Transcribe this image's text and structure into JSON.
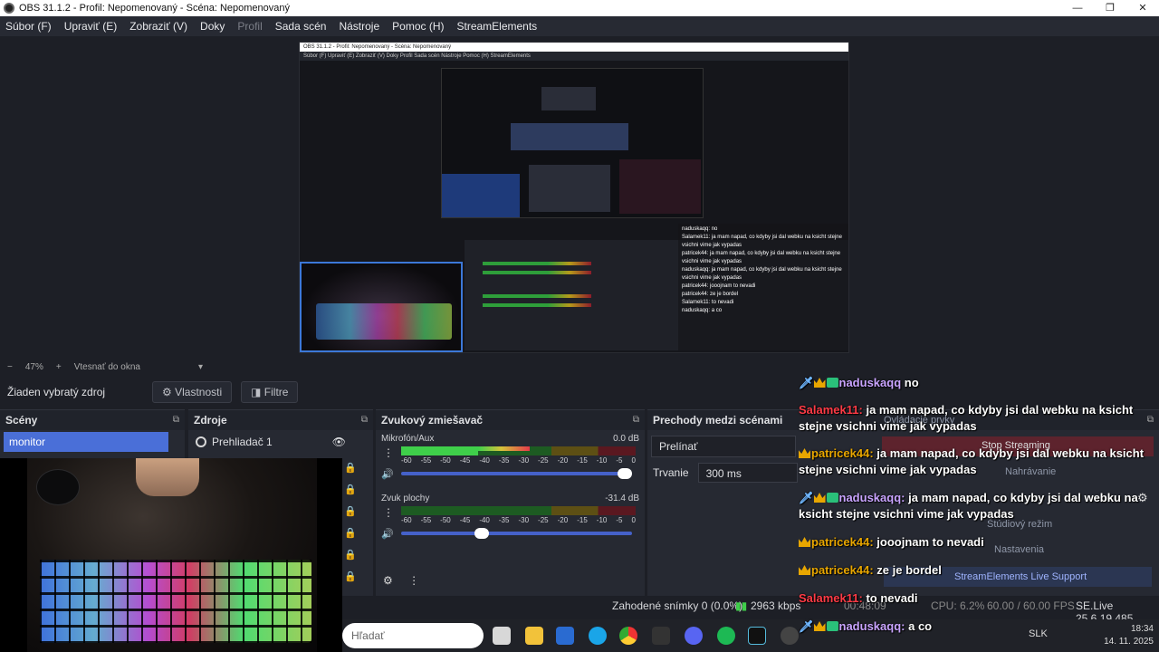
{
  "window": {
    "title": "OBS 31.1.2 - Profil: Nepomenovaný - Scéna: Nepomenovaný",
    "minimize": "—",
    "maximize": "❐",
    "close": "✕"
  },
  "menu": [
    "Súbor (F)",
    "Upraviť (E)",
    "Zobraziť (V)",
    "Doky",
    "Profil",
    "Sada scén",
    "Nástroje",
    "Pomoc (H)",
    "StreamElements"
  ],
  "preview_controls": {
    "zoom_out": "−",
    "zoom": "47%",
    "zoom_in": "+",
    "fit": "Vtesnať do okna",
    "fit_caret": "▾"
  },
  "nested_preview": {
    "title": "OBS 31.1.2 - Profil: Nepomenovaný - Scéna: Nepomenovaný",
    "menu": "Súbor (F)   Upraviť (E)   Zobraziť (V)   Doky   Profil   Sada scén   Nástroje   Pomoc (H)   StreamElements",
    "chat": [
      "naduskaqq: no",
      "Salamek11: ja mam napad, co kdyby jsi dal webku na ksicht stejne vsichni vime jak vypadas",
      "patricek44: ja mam napad, co kdyby jsi dal webku na ksicht stejne vsichni vime jak vypadas",
      "naduskaqq: ja mam napad, co kdyby jsi dal webku na ksicht stejne vsichni vime jak vypadas",
      "patricek44: jooojnam to nevadi",
      "patricek44: ze je bordel",
      "Salamek11: to nevadi",
      "naduskaqq: a co"
    ]
  },
  "source_bar": {
    "no_source": "Žiaden vybratý zdroj",
    "properties": "Vlastnosti",
    "filters": "Filtre"
  },
  "docks": {
    "scenes": {
      "title": "Scény",
      "items": [
        "monitor"
      ]
    },
    "sources": {
      "title": "Zdroje",
      "items": [
        "Prehliadač 1"
      ]
    },
    "mixer": {
      "title": "Zvukový zmiešavač",
      "scale": [
        "-60",
        "-55",
        "-50",
        "-45",
        "-40",
        "-35",
        "-30",
        "-25",
        "-20",
        "-15",
        "-10",
        "-5",
        "0"
      ],
      "channels": [
        {
          "name": "Mikrofón/Aux",
          "db": "0.0 dB",
          "level": 0.55,
          "volume": 1.0
        },
        {
          "name": "Zvuk plochy",
          "db": "-31.4 dB",
          "level": 0.5,
          "volume": 0.35
        }
      ]
    },
    "transitions": {
      "title": "Prechody medzi scénami",
      "type": "Prelínať",
      "duration_label": "Trvanie",
      "duration": "300 ms"
    },
    "controls_ghost": {
      "title": "Ovládacie prvky",
      "stop_streaming": "Stop Streaming",
      "recording": "Nahrávanie",
      "studio_mode": "Štúdiový režim",
      "settings": "Nastavenia",
      "support": "StreamElements Live Support"
    }
  },
  "status": {
    "dropped": "Zahodené snímky 0 (0.0%)",
    "bitrate": "2963 kbps",
    "time": "00:48:09",
    "cpu": "CPU: 6.2%",
    "fps": "60.00 / 60.00 FPS",
    "version": "SE.Live 25.6.19.485"
  },
  "chat": [
    {
      "user": "naduskaqq",
      "color": "#c9a4ff",
      "badges": [
        "sword",
        "crown",
        "gift"
      ],
      "text": "no"
    },
    {
      "user": "Salamek11:",
      "color": "#ff3b46",
      "badges": [],
      "text": "ja mam napad, co kdyby jsi dal webku na ksicht stejne vsichni vime jak vypadas"
    },
    {
      "user": "patricek44:",
      "color": "#e8a600",
      "badges": [
        "crown"
      ],
      "text": "ja mam napad, co kdyby jsi dal webku na ksicht stejne vsichni vime jak vypadas"
    },
    {
      "user": "naduskaqq:",
      "color": "#c9a4ff",
      "badges": [
        "sword",
        "crown",
        "gift"
      ],
      "text": "ja mam napad, co kdyby jsi dal webku na ksicht stejne vsichni vime jak vypadas"
    },
    {
      "user": "patricek44:",
      "color": "#e8a600",
      "badges": [
        "crown"
      ],
      "text": "jooojnam to nevadi"
    },
    {
      "user": "patricek44:",
      "color": "#e8a600",
      "badges": [
        "crown"
      ],
      "text": "ze je bordel"
    },
    {
      "user": "Salamek11:",
      "color": "#ff3b46",
      "badges": [],
      "text": "to nevadi"
    },
    {
      "user": "naduskaqq:",
      "color": "#c9a4ff",
      "badges": [
        "sword",
        "crown",
        "gift"
      ],
      "text": "a co"
    }
  ],
  "taskbar": {
    "search_placeholder": "Hľadať",
    "clock_time": "18:34",
    "clock_date": "14. 11. 2025",
    "lang": "SLK"
  }
}
